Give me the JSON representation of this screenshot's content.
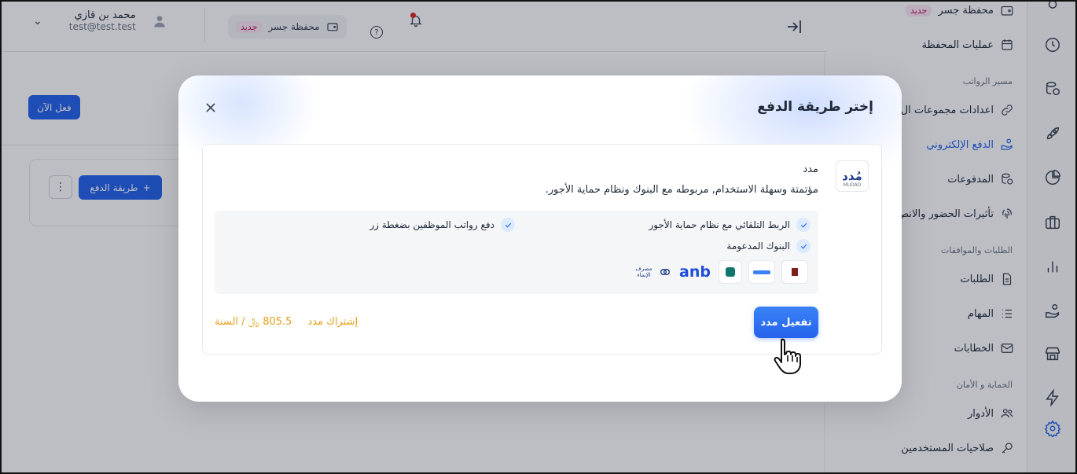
{
  "topbar": {
    "user_name": "محمد بن قازي",
    "user_email": "test@test.test",
    "wallet_label": "محفظة جسر",
    "wallet_badge": "جديد"
  },
  "background": {
    "activate_now_label": "فعل الآن",
    "add_payment_method_label": "طريقة الدفع"
  },
  "sidebar": {
    "items": [
      {
        "label": "محفظة جسر",
        "badge": "جديد"
      },
      {
        "label": "عمليات المحفظة"
      },
      {
        "section": "مسير الرواتب"
      },
      {
        "label": "اعدادات مجموعات ال"
      },
      {
        "label": "الدفع الإلكتروني",
        "active": true
      },
      {
        "label": "المدفوعات"
      },
      {
        "label": "تأثيرات الحضور والانص"
      },
      {
        "section": "الطلبات والموافقات"
      },
      {
        "label": "الطلبات"
      },
      {
        "label": "المهام"
      },
      {
        "label": "الخطابات"
      },
      {
        "section": "الحماية و الأمان"
      },
      {
        "label": "الأدوار"
      },
      {
        "label": "صلاحيات المستخدمين"
      }
    ]
  },
  "modal": {
    "title": "إختر طريقة الدفع",
    "close_icon": "close-icon",
    "option": {
      "logo_text": "مُدد",
      "logo_caption": "MUDAD",
      "name": "مدد",
      "description": "مؤتمتة وسهلة الاستخدام, مربوطه مع البنوك ونظام حماية الأجور.",
      "features": [
        "الربط التلقائي مع نظام حماية الأجور",
        "دفع رواتب الموظفين بضغطة زر",
        "البنوك المدعومة"
      ],
      "banks": [
        "anb",
        "مصرف الإنماء alinma bank"
      ],
      "activate_label": "تفعيل مدد",
      "subscription_label": "إشتراك مدد",
      "price_text": "805.5 ﷼ / السنة"
    }
  },
  "colors": {
    "accent": "#2563eb",
    "price": "#e4a11b",
    "badge_text": "#be185d"
  }
}
